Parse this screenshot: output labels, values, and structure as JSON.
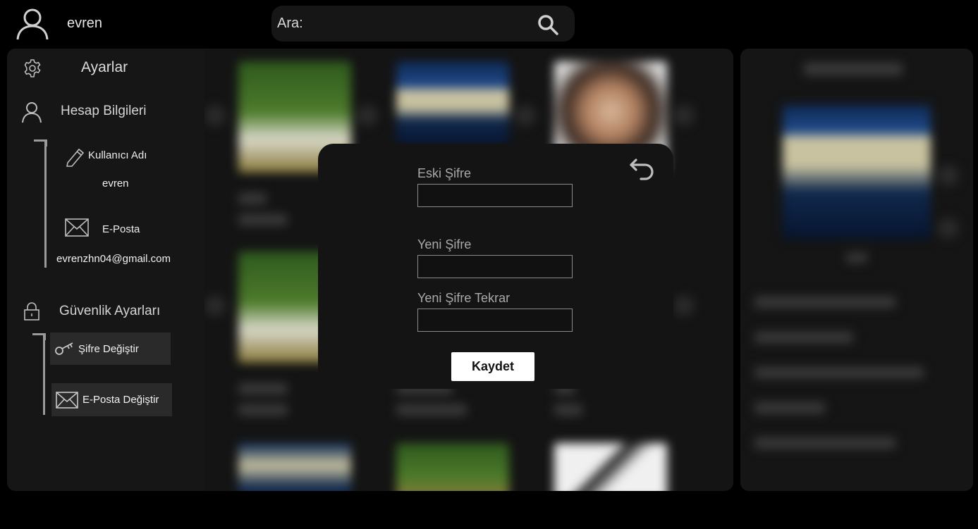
{
  "header": {
    "username": "evren",
    "search_label": "Ara:",
    "search_value": ""
  },
  "sidebar": {
    "title": "Ayarlar",
    "account_section": "Hesap Bilgileri",
    "username_label": "Kullanıcı Adı",
    "username_value": "evren",
    "email_label": "E-Posta",
    "email_value": "evrenzhn04@gmail.com",
    "security_section": "Güvenlik Ayarları",
    "change_password": "Şifre Değiştir",
    "change_email": "E-Posta Değiştir"
  },
  "modal": {
    "old_password_label": "Eski Şifre",
    "new_password_label": "Yeni Şifre",
    "new_password_repeat_label": "Yeni Şifre Tekrar",
    "save_label": "Kaydet"
  },
  "icons": {
    "avatar": "user-icon",
    "search": "search-icon",
    "settings": "gear-icon",
    "account": "user-icon",
    "edit": "pencil-icon",
    "email": "envelope-icon",
    "security": "lock-icon",
    "key": "key-icon",
    "back": "undo-arrow-icon"
  },
  "colors": {
    "background": "#000000",
    "panel": "#161616",
    "modal": "#141414",
    "button": "#ffffff",
    "selected_item": "#2a2a2a"
  }
}
